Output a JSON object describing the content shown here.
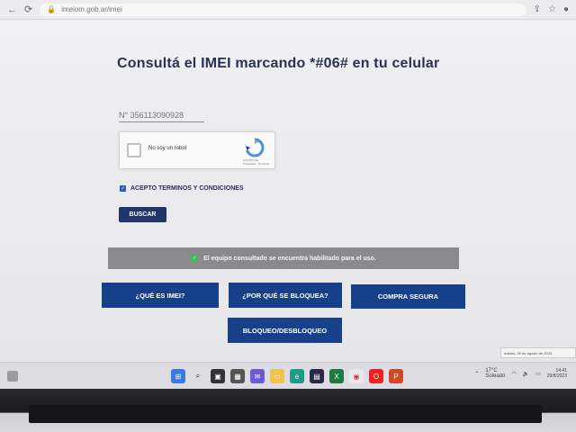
{
  "browser": {
    "url": "imeiom.gob.ar/imei",
    "icons": [
      "back-icon",
      "reload-icon",
      "lock-icon",
      "share-icon",
      "star-icon",
      "profile-icon"
    ]
  },
  "page": {
    "title": "Consultá el IMEI marcando *#06# en tu celular",
    "imei_input": {
      "value": "",
      "placeholder": "N° 356113090928"
    },
    "recaptcha": {
      "label": "No soy un robot",
      "brand": "reCAPTCHA",
      "links": "Privacidad - Términos",
      "checked": false
    },
    "terms": {
      "label": "ACEPTO TERMINOS Y CONDICIONES",
      "checked": true
    },
    "search_button": "BUSCAR",
    "status": {
      "message": "El equipo consultado se encuentra habilitado para el uso.",
      "color": "#3fbf4f"
    },
    "buttons": {
      "what_is_imei": "¿QUÉ ES IMEI?",
      "why_blocked": "¿POR QUÉ SE BLOQUEA?",
      "safe_purchase": "COMPRA SEGURA",
      "block_unblock": "BLOQUEO/DESBLOQUEO"
    },
    "date_tooltip": "martes, 29 de agosto de 2023"
  },
  "taskbar": {
    "icons": [
      "windows-icon",
      "search-icon",
      "task-view-icon",
      "widgets-icon",
      "chat-icon",
      "file-explorer-icon",
      "edge-icon",
      "store-icon",
      "excel-icon",
      "chrome-icon",
      "opera-icon",
      "powerpoint-icon"
    ],
    "tray": {
      "temperature": "17°C",
      "weather": "Soleado",
      "time": "14:41",
      "date": "29/8/2023"
    }
  },
  "colors": {
    "primary": "#16418a",
    "dark_button": "#22356b",
    "status_bg": "#8a8a8d"
  }
}
